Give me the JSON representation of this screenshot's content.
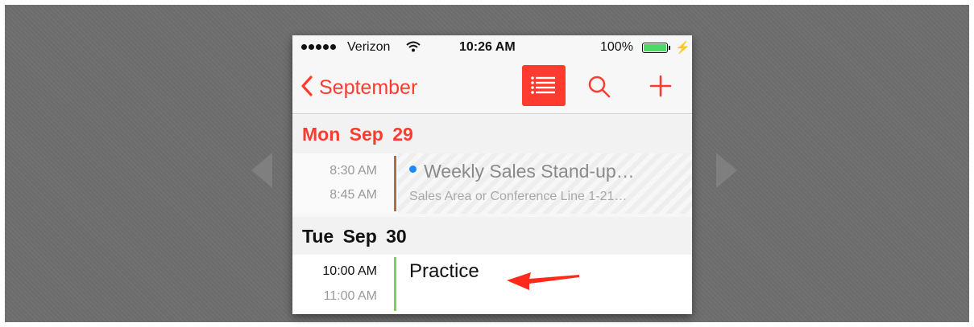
{
  "status_bar": {
    "carrier": "Verizon",
    "time": "10:26 AM",
    "battery": "100%"
  },
  "nav": {
    "back_label": "September",
    "icons": [
      "chevron-left-icon",
      "list-icon",
      "search-icon",
      "plus-icon"
    ]
  },
  "days": [
    {
      "header": "Mon Sep 29",
      "events": [
        {
          "start": "8:30 AM",
          "end": "8:45 AM",
          "title": "Weekly Sales Stand-up…",
          "location": "Sales Area or Conference Line 1-21…",
          "calendar_color": "#1e88ff"
        }
      ]
    },
    {
      "header": "Tue Sep 30",
      "events": [
        {
          "start": "10:00 AM",
          "end": "11:00 AM",
          "title": "Practice",
          "calendar_color": "#7ed05a"
        }
      ]
    }
  ],
  "colors": {
    "accent": "#ff3b30",
    "annotation": "#ff2a1a"
  }
}
